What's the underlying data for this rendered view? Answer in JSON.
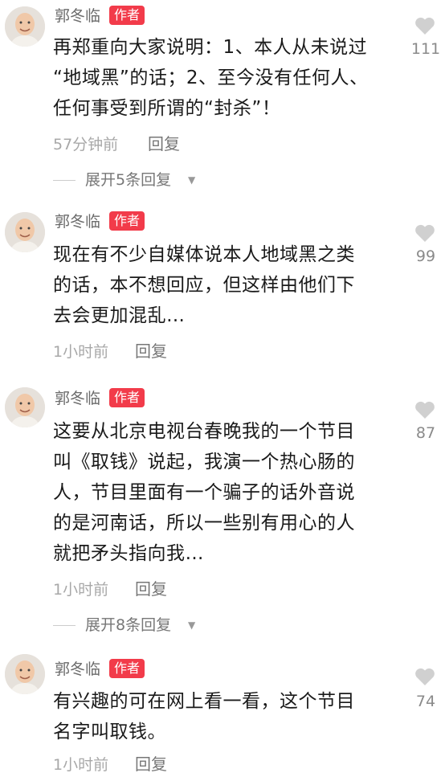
{
  "comments": [
    {
      "author": "郭冬临",
      "badge": "作者",
      "lines": [
        "再郑重向大家说明：1、本人从未说过",
        "“地域黑”的话；2、至今没有任何人、",
        "任何事受到所谓的“封杀”！"
      ],
      "time": "57分钟前",
      "reply": "回复",
      "likes": "111",
      "expand": "展开5条回复"
    },
    {
      "author": "郭冬临",
      "badge": "作者",
      "lines": [
        "现在有不少自媒体说本人地域黑之类",
        "的话，本不想回应，但这样由他们下",
        "去会更加混乱…"
      ],
      "time": "1小时前",
      "reply": "回复",
      "likes": "99"
    },
    {
      "author": "郭冬临",
      "badge": "作者",
      "lines": [
        "这要从北京电视台春晚我的一个节目",
        "叫《取钱》说起，我演一个热心肠的",
        "人，节目里面有一个骗子的话外音说",
        "的是河南话，所以一些别有用心的人",
        "就把矛头指向我…"
      ],
      "time": "1小时前",
      "reply": "回复",
      "likes": "87",
      "expand": "展开8条回复"
    },
    {
      "author": "郭冬临",
      "badge": "作者",
      "lines": [
        "有兴趣的可在网上看一看，这个节目",
        "名字叫取钱。"
      ],
      "time": "1小时前",
      "reply": "回复",
      "likes": "74"
    }
  ],
  "icons": {
    "like": "heart-icon",
    "expand_caret": "chevron-down-icon",
    "avatar": "avatar-icon"
  },
  "colors": {
    "badge": "#f23b4a",
    "heart": "#d0d0d0",
    "text": "#1a1a1a",
    "meta": "#a8a8a8"
  }
}
